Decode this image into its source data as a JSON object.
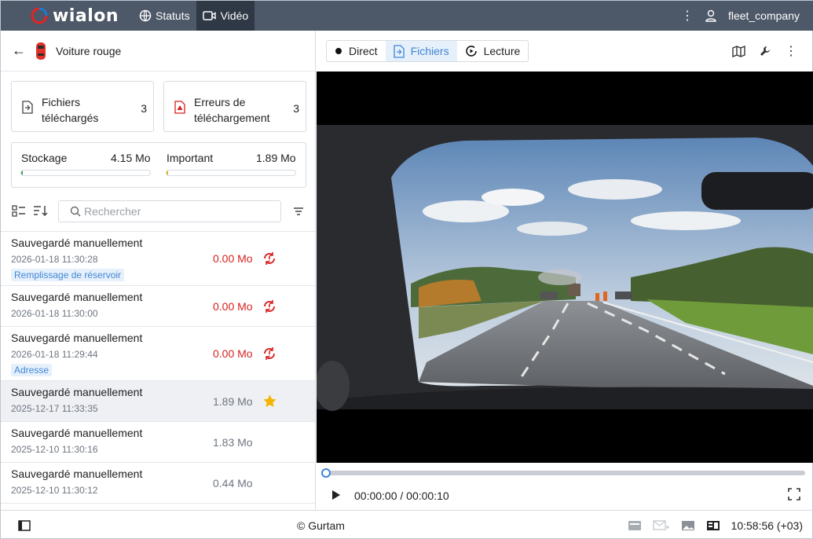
{
  "header": {
    "brand": "wialon",
    "nav": [
      {
        "label": "Statuts",
        "icon": "globe-icon"
      },
      {
        "label": "Vidéo",
        "icon": "video-camera-icon"
      }
    ],
    "account": "fleet_company"
  },
  "vehicle": {
    "name": "Voiture rouge",
    "icon": "red-car-icon"
  },
  "summary": {
    "files_label": "Fichiers téléchargés",
    "files_count": "3",
    "errors_label": "Erreurs de téléchargement",
    "errors_count": "3"
  },
  "storage": {
    "storage_label": "Stockage",
    "storage_value": "4.15 Mo",
    "storage_fill": 0.01,
    "important_label": "Important",
    "important_value": "1.89 Mo",
    "important_fill": 0.01
  },
  "search": {
    "placeholder": "Rechercher"
  },
  "files": [
    {
      "title": "Sauvegardé manuellement",
      "date": "2026-01-18 11:30:28",
      "tag": "Remplissage de réservoir",
      "size": "0.00 Mo",
      "status": "error",
      "icon": "retry-upload-icon"
    },
    {
      "title": "Sauvegardé manuellement",
      "date": "2026-01-18 11:30:00",
      "tag": "",
      "size": "0.00 Mo",
      "status": "error",
      "icon": "retry-upload-icon"
    },
    {
      "title": "Sauvegardé manuellement",
      "date": "2026-01-18 11:29:44",
      "tag": "Adresse",
      "size": "0.00 Mo",
      "status": "error",
      "icon": "retry-upload-icon"
    },
    {
      "title": "Sauvegardé manuellement",
      "date": "2025-12-17 11:33:35",
      "tag": "",
      "size": "1.89 Mo",
      "status": "ok",
      "icon": "star-icon"
    },
    {
      "title": "Sauvegardé manuellement",
      "date": "2025-12-10 11:30:16",
      "tag": "",
      "size": "1.83 Mo",
      "status": "ok",
      "icon": ""
    },
    {
      "title": "Sauvegardé manuellement",
      "date": "2025-12-10 11:30:12",
      "tag": "",
      "size": "0.44 Mo",
      "status": "ok",
      "icon": ""
    }
  ],
  "modes": [
    {
      "label": "Direct",
      "icon": "live-dot-icon"
    },
    {
      "label": "Fichiers",
      "icon": "file-icon"
    },
    {
      "label": "Lecture",
      "icon": "playback-icon"
    }
  ],
  "player": {
    "time": "00:00:00 / 00:00:10",
    "progress": 0.0
  },
  "footer": {
    "copyright": "© Gurtam",
    "clock": "10:58:56 (+03)"
  },
  "colors": {
    "accent": "#3f86d6",
    "error": "#d71f1f",
    "topbar": "#4d5868",
    "star": "#f5b400",
    "storage_fill": "#2fa84f",
    "important_fill": "#e2b400"
  }
}
